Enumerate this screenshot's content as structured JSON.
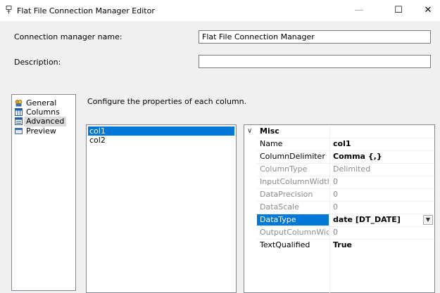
{
  "window": {
    "title": "Flat File Connection Manager Editor",
    "minimize_glyph": "—",
    "maximize_glyph": "☐",
    "close_glyph": "✕",
    "icon": "app-icon"
  },
  "form": {
    "name_label": "Connection manager name:",
    "name_value": "Flat File Connection Manager",
    "description_label": "Description:",
    "description_value": ""
  },
  "nav": {
    "items": [
      {
        "label": "General",
        "icon": "general-icon",
        "selected": false
      },
      {
        "label": "Columns",
        "icon": "columns-icon",
        "selected": false
      },
      {
        "label": "Advanced",
        "icon": "advanced-icon",
        "selected": true
      },
      {
        "label": "Preview",
        "icon": "preview-icon",
        "selected": false
      }
    ]
  },
  "main": {
    "instruction": "Configure the properties of each column.",
    "columns": [
      "col1",
      "col2"
    ],
    "selected_column": "col1"
  },
  "properties": {
    "category": "Misc",
    "rows": [
      {
        "name": "Name",
        "value": "col1"
      },
      {
        "name": "ColumnDelimiter",
        "value": "Comma {,}"
      },
      {
        "name": "ColumnType",
        "value": "Delimited"
      },
      {
        "name": "InputColumnWidth",
        "value": "0"
      },
      {
        "name": "DataPrecision",
        "value": "0"
      },
      {
        "name": "DataScale",
        "value": "0"
      },
      {
        "name": "DataType",
        "value": "date [DT_DATE]"
      },
      {
        "name": "OutputColumnWidth",
        "value": "0"
      },
      {
        "name": "TextQualified",
        "value": "True"
      }
    ]
  },
  "colors": {
    "selection": "#0078d7",
    "disabled_text": "#8c8c8c"
  }
}
